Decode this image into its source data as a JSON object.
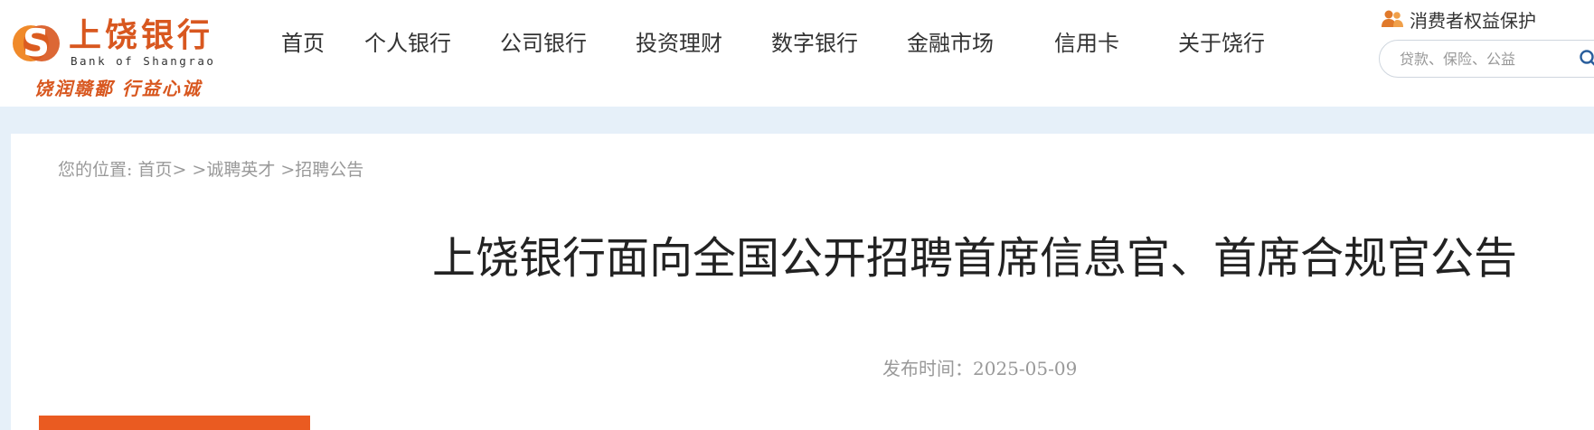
{
  "brand": {
    "name": "上饶银行",
    "name_en": "Bank of Shangrao",
    "slogan": "饶润赣鄱 行益心诚",
    "color": "#d8571f"
  },
  "nav": {
    "items": [
      {
        "label": "首页"
      },
      {
        "label": "个人银行"
      },
      {
        "label": "公司银行"
      },
      {
        "label": "投资理财"
      },
      {
        "label": "数字银行"
      },
      {
        "label": "金融市场"
      },
      {
        "label": "信用卡"
      },
      {
        "label": "关于饶行"
      }
    ]
  },
  "topbar": {
    "consumer_label": "消费者权益保护",
    "consumer_icon": "people-icon"
  },
  "search": {
    "placeholder": "贷款、保险、公益",
    "value": "",
    "icon": "search-icon"
  },
  "breadcrumb": {
    "prefix": "您的位置: ",
    "items": [
      "首页>",
      " >诚聘英才",
      " >招聘公告"
    ]
  },
  "article": {
    "title": "上饶银行面向全国公开招聘首席信息官、首席合规官公告",
    "publish_label": "发布时间：",
    "publish_date": "2025-05-09"
  },
  "colors": {
    "accent": "#ea5b21",
    "band": "#e6f0f9",
    "muted_text": "#999999"
  }
}
